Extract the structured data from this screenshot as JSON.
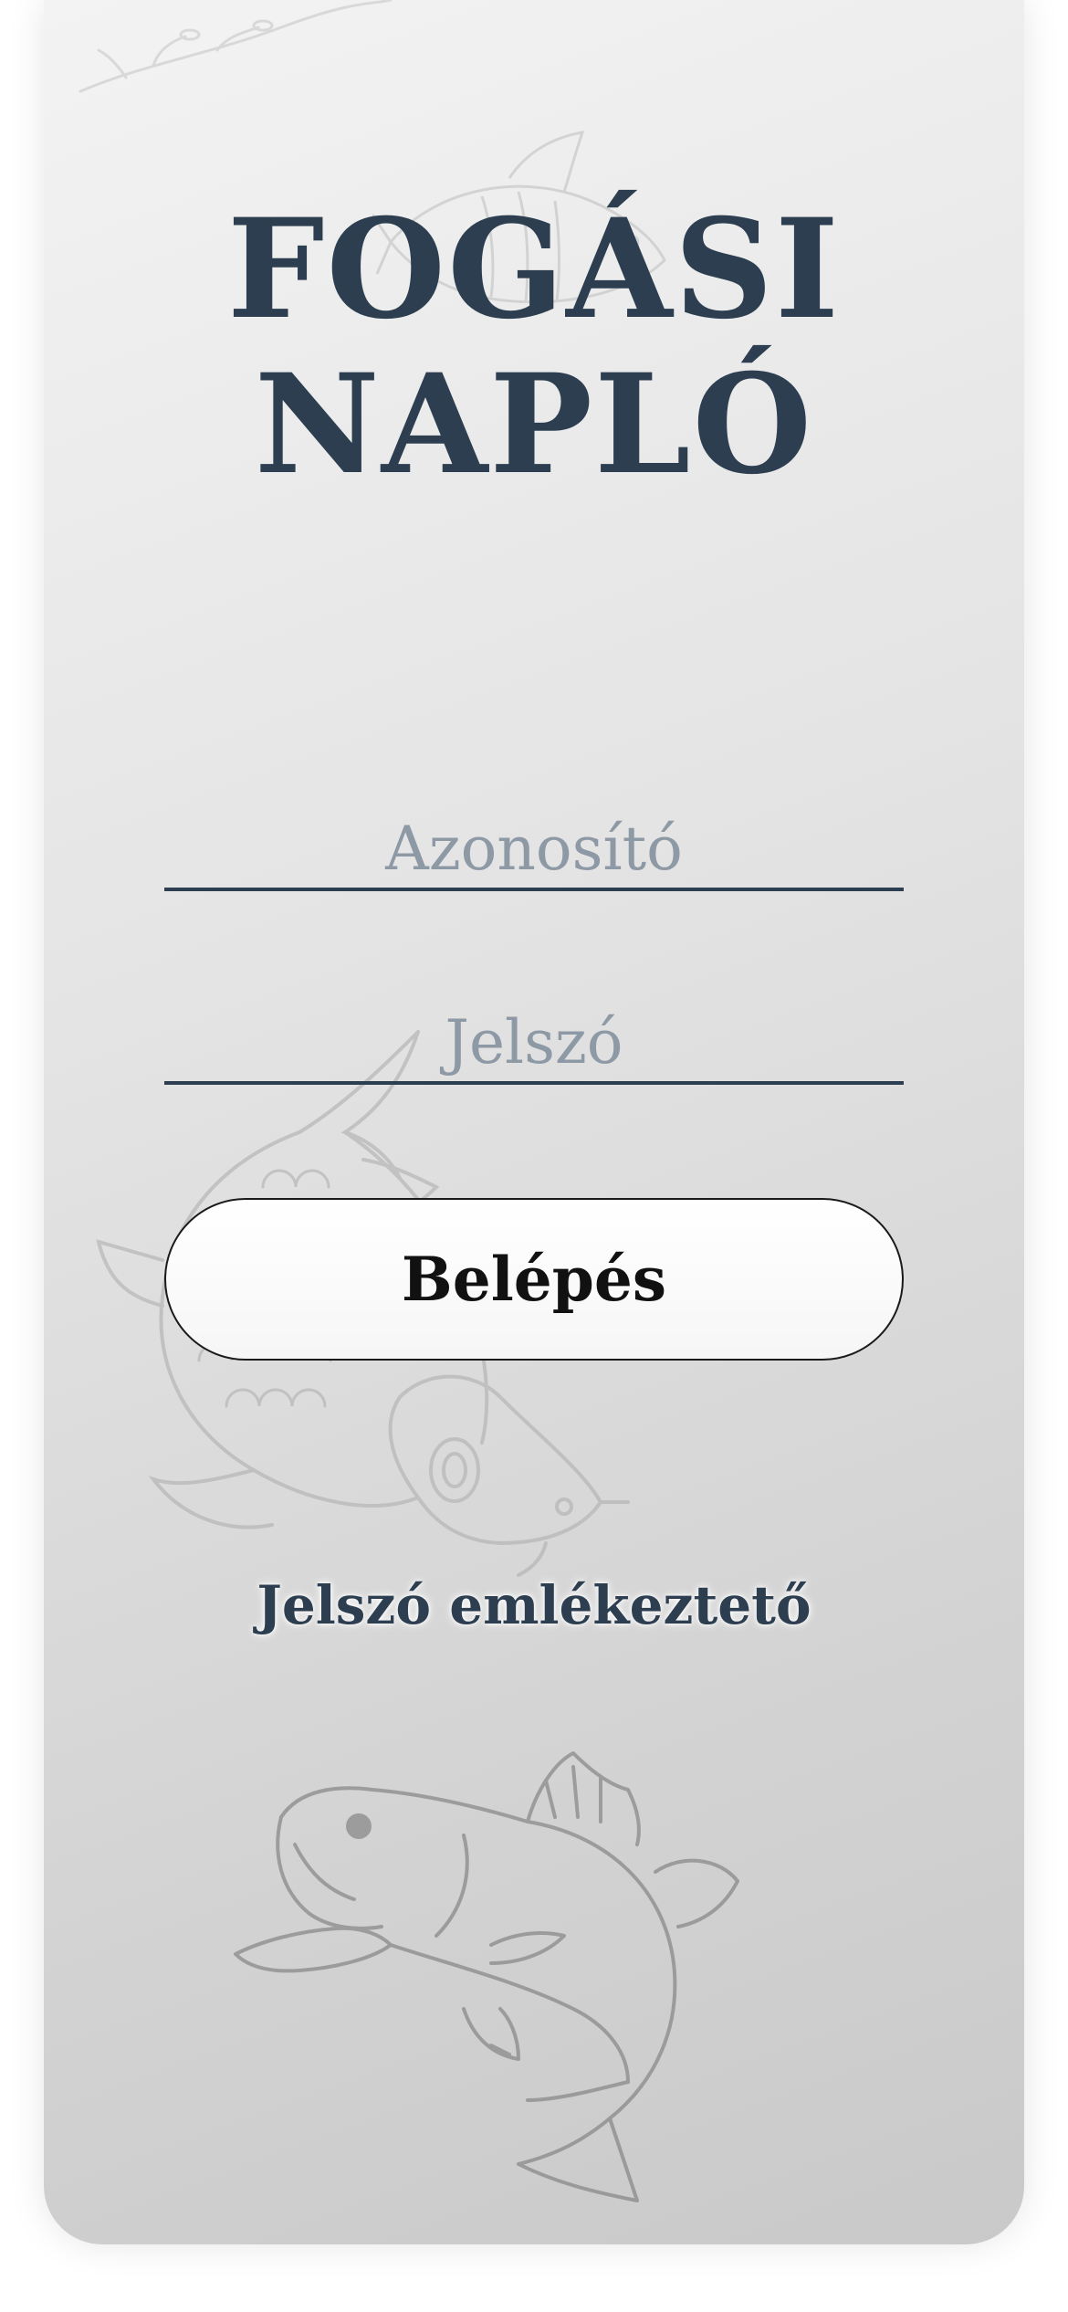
{
  "app": {
    "title_line1": "FOGÁSI",
    "title_line2": "NAPLÓ"
  },
  "form": {
    "username_placeholder": "Azonosító",
    "username_value": "",
    "password_placeholder": "Jelszó",
    "password_value": "",
    "login_label": "Belépés",
    "remind_label": "Jelszó emlékeztető"
  },
  "decorations": {
    "icons": [
      "branch-sketch-icon",
      "small-fish-sketch-icon",
      "carp-sketch-icon",
      "bass-sketch-icon"
    ]
  },
  "colors": {
    "accent": "#2c3e50",
    "placeholder": "#8e99a6",
    "sketch": "#8a8a8a"
  }
}
